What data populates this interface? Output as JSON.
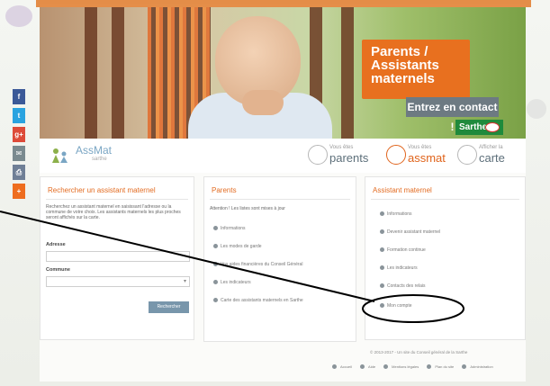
{
  "hero": {
    "headline_lines": [
      "Parents /",
      "Assistants",
      "maternels"
    ],
    "contact_button": "Entrez en contact !",
    "badge": "Sarthe"
  },
  "logo": {
    "name": "AssMat",
    "sub": "sarthe"
  },
  "nav": [
    {
      "small": "Vous êtes",
      "big": "parents",
      "color": "#5d6f7a"
    },
    {
      "small": "Vous êtes",
      "big": "assmat",
      "color": "#e0641c"
    },
    {
      "small": "Afficher la",
      "big": "carte",
      "color": "#5d6f7a"
    }
  ],
  "search": {
    "title": "Rechercher un assistant maternel",
    "intro": "Recherchez un assistant maternel en saisissant l'adresse ou la commune de votre choix. Les assistants maternels les plus proches seront affichés sur la carte.",
    "address_label": "Adresse",
    "commune_label": "Commune",
    "button": "Rechercher"
  },
  "parents": {
    "title": "Parents",
    "note": "Attention ! Les listes sont mises à jour",
    "items": [
      "Informations",
      "Les modes de garde",
      "Vos aides financières du Conseil Général",
      "Les indicateurs",
      "Carte des assistants maternels en Sarthe"
    ]
  },
  "assmat": {
    "title": "Assistant maternel",
    "items": [
      "Informations",
      "Devenir assistant maternel",
      "Formation continue",
      "Les indicateurs",
      "Contacts des relais",
      "Mon compte"
    ]
  },
  "social": [
    {
      "icon": "facebook-icon",
      "glyph": "f",
      "color": "#3b5998"
    },
    {
      "icon": "twitter-icon",
      "glyph": "t",
      "color": "#2aa3e0"
    },
    {
      "icon": "google-plus-icon",
      "glyph": "g+",
      "color": "#dd4b39"
    },
    {
      "icon": "email-icon",
      "glyph": "✉",
      "color": "#7a8a8f"
    },
    {
      "icon": "print-icon",
      "glyph": "⎙",
      "color": "#6f7f96"
    },
    {
      "icon": "add-icon",
      "glyph": "+",
      "color": "#ee6d1f"
    }
  ],
  "footer": {
    "copyright": "© 2013-2017 - Un site du Conseil général de la Sarthe",
    "links": [
      "Accueil",
      "Aide",
      "Mentions légales",
      "Plan du site",
      "Administration"
    ]
  }
}
